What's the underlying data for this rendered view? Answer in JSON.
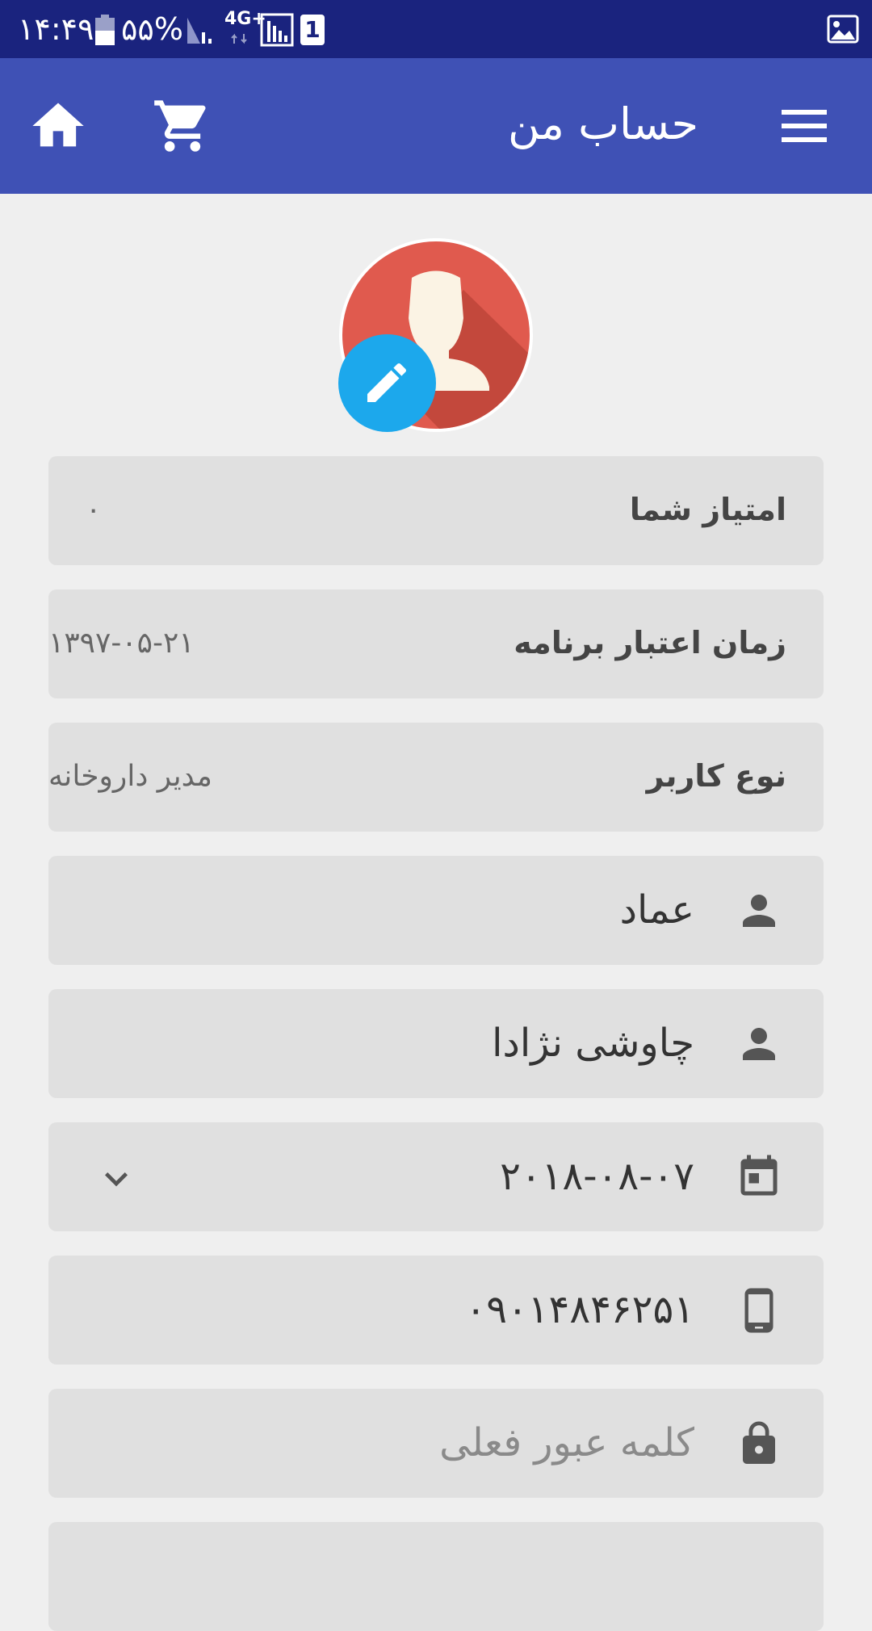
{
  "status_bar": {
    "time": "۱۴:۴۹",
    "battery": "۵۵%",
    "network": "4G+",
    "sim_badge": "1"
  },
  "app_bar": {
    "title": "حساب من",
    "icons": [
      "menu-icon",
      "cart-icon",
      "home-icon"
    ]
  },
  "profile": {
    "avatar_icon": "user-avatar-icon",
    "edit_icon": "pencil-icon"
  },
  "info_rows": [
    {
      "label": "امتیاز شما",
      "value": "۰"
    },
    {
      "label": "زمان اعتبار برنامه",
      "value": "۱۳۹۷-۰۵-۲۱"
    },
    {
      "label": "نوع کاربر",
      "value": "مدیر داروخانه"
    }
  ],
  "fields": {
    "first_name": {
      "value": "عماد",
      "icon": "person-icon"
    },
    "last_name": {
      "value": "چاوشی نژادا",
      "icon": "person-icon"
    },
    "birth_date": {
      "value": "۲۰۱۸-۰۸-۰۷",
      "icon": "calendar-icon"
    },
    "phone": {
      "value": "۰۹۰۱۴۸۴۶۲۵۱",
      "icon": "phone-icon"
    },
    "current_password": {
      "placeholder": "کلمه عبور فعلی",
      "icon": "lock-icon"
    }
  },
  "colors": {
    "status_bar": "#1a237e",
    "app_bar": "#3f51b5",
    "fab": "#1ca8ec",
    "avatar": "#e05a4e",
    "card": "#e0e0e0",
    "background": "#efefef"
  }
}
